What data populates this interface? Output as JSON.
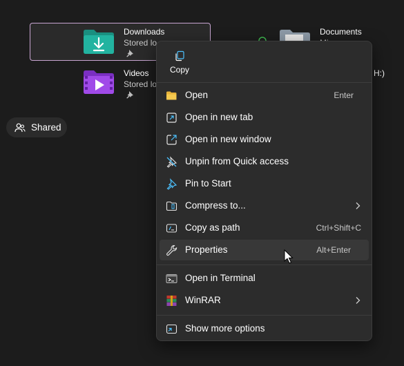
{
  "tiles": {
    "downloads": {
      "name": "Downloads",
      "sub": "Stored lo"
    },
    "videos": {
      "name": "Videos",
      "sub": "Stored lo"
    },
    "documents": {
      "name": "Documents",
      "sub": "Mi"
    },
    "drive_fragment": "H:)"
  },
  "sidebar": {
    "shared_label": "Shared"
  },
  "context_menu": {
    "copy_label": "Copy",
    "items": [
      {
        "label": "Open",
        "shortcut": "Enter",
        "icon": "folder-open-icon"
      },
      {
        "label": "Open in new tab",
        "shortcut": "",
        "icon": "new-tab-icon"
      },
      {
        "label": "Open in new window",
        "shortcut": "",
        "icon": "new-window-icon"
      },
      {
        "label": "Unpin from Quick access",
        "shortcut": "",
        "icon": "unpin-icon"
      },
      {
        "label": "Pin to Start",
        "shortcut": "",
        "icon": "pin-icon"
      },
      {
        "label": "Compress to...",
        "shortcut": "",
        "icon": "zip-folder-icon",
        "submenu": true
      },
      {
        "label": "Copy as path",
        "shortcut": "Ctrl+Shift+C",
        "icon": "copy-path-icon"
      },
      {
        "label": "Properties",
        "shortcut": "Alt+Enter",
        "icon": "wrench-icon",
        "hovered": true
      },
      {
        "label": "Open in Terminal",
        "shortcut": "",
        "icon": "terminal-icon"
      },
      {
        "label": "WinRAR",
        "shortcut": "",
        "icon": "winrar-icon",
        "submenu": true
      },
      {
        "label": "Show more options",
        "shortcut": "",
        "icon": "more-options-icon"
      }
    ]
  },
  "colors": {
    "background": "#1c1c1c",
    "menu": "#2c2c2c",
    "selection_border": "#c9a6d3",
    "downloads_folder": "#1fa896",
    "videos_folder": "#9b45e4",
    "accent_blue": "#4cc2ff"
  }
}
